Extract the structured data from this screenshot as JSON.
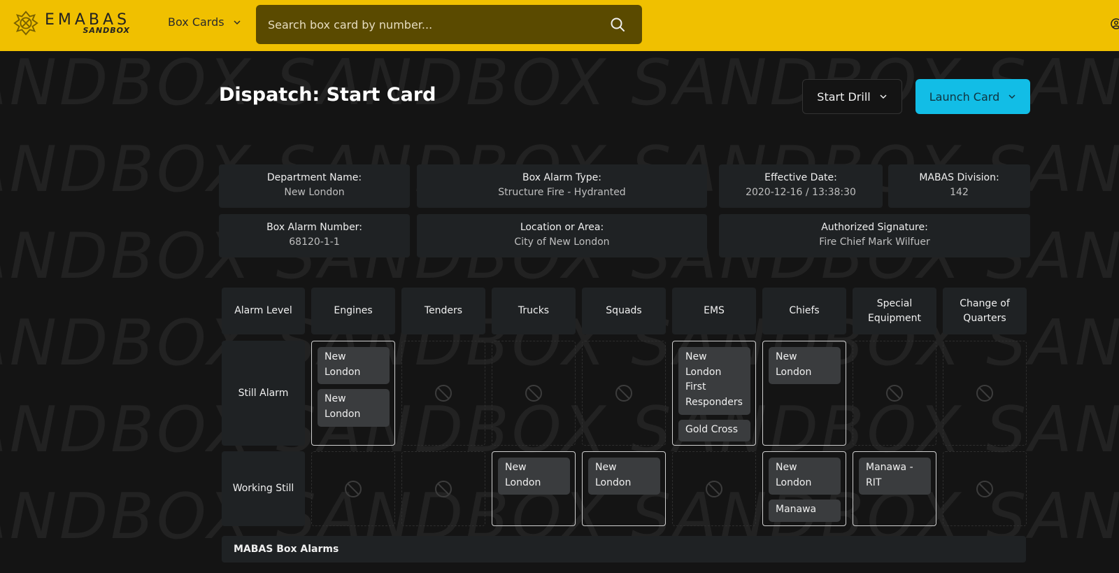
{
  "header": {
    "logo_main": "EMABAS",
    "logo_sub": "SANDBOX",
    "nav_label": "Box Cards",
    "search_placeholder": "Search box card by number..."
  },
  "watermark_text": "ANDBOX   SANDBOX   SANDBOX   SAND",
  "page": {
    "title": "Dispatch: Start Card",
    "start_drill_label": "Start Drill",
    "launch_card_label": "Launch Card"
  },
  "info": {
    "department_label": "Department Name:",
    "department_value": "New London",
    "alarm_type_label": "Box Alarm Type:",
    "alarm_type_value": "Structure Fire - Hydranted",
    "effective_label": "Effective Date:",
    "effective_value": "2020-12-16 / 13:38:30",
    "division_label": "MABAS Division:",
    "division_value": "142",
    "number_label": "Box Alarm Number:",
    "number_value": "68120-1-1",
    "location_label": "Location or Area:",
    "location_value": "City of New London",
    "signature_label": "Authorized Signature:",
    "signature_value": "Fire Chief Mark Wilfuer"
  },
  "columns": [
    "Alarm Level",
    "Engines",
    "Tenders",
    "Trucks",
    "Squads",
    "EMS",
    "Chiefs",
    "Special Equipment",
    "Change of Quarters"
  ],
  "rows": [
    {
      "level": "Still Alarm",
      "cells": [
        [
          "New London",
          "New London"
        ],
        [],
        [],
        [],
        [
          "New London First Responders",
          "Gold Cross"
        ],
        [
          "New London"
        ],
        [],
        []
      ]
    },
    {
      "level": "Working Still",
      "cells": [
        [],
        [],
        [
          "New London"
        ],
        [
          "New London"
        ],
        [],
        [
          "New London",
          "Manawa"
        ],
        [
          "Manawa - RIT"
        ],
        []
      ]
    }
  ],
  "section_title": "MABAS Box Alarms"
}
